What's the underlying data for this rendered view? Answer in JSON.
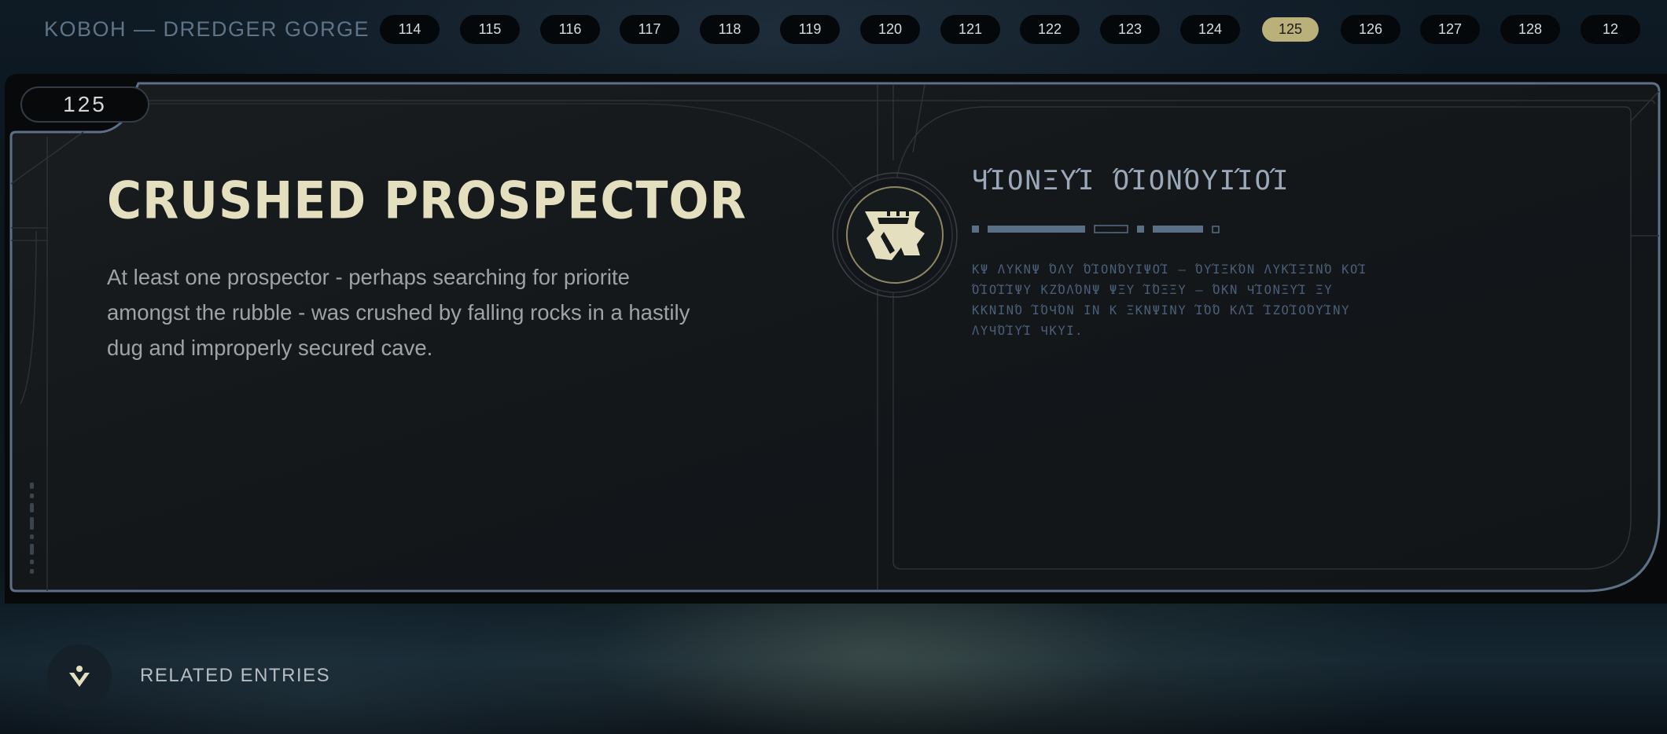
{
  "header": {
    "location": "KOBOH — DREDGER GORGE",
    "entries": [
      "114",
      "115",
      "116",
      "117",
      "118",
      "119",
      "120",
      "121",
      "122",
      "123",
      "124",
      "125",
      "126",
      "127",
      "128",
      "12"
    ],
    "active_entry": "125"
  },
  "entry": {
    "number": "125",
    "title": "CRUSHED PROSPECTOR",
    "description": "At least one prospector - perhaps searching for priorite amongst the rubble - was crushed by falling rocks in a hastily dug and improperly secured cave.",
    "aurebesh_title": "ЧΊΟΝΞΥΊ ΌΊΟΝΌΥΙΊΟΊ",
    "aurebesh_lines": [
      "ΚΨ ΛΥΚΝΨ ΌΛΥ ΌΊΟΝΌΥΙΨΟΊ – ΌΥΊΞΚΌΝ ΛΥΚΊΞΙΝΌ ΚΟΊ",
      "ΌΊΟΊΊΨΥ ΚΖΌΛΌΝΨ ΨΞΥ ΊΌΞΞΥ – ΌΚΝ ЧΊΟΝΞΥΊ ΞΥ",
      "ΚΚΝΙΝΌ ΊΌЧΌΝ ΙΝ Κ ΞΚΝΨΙΝΥ ΊΌΌ ΚΛΊ ΊΖΟΊΟΌΥΊΝΥ",
      "ΛΥЧΌΊΥΊ ЧΚΥΙ."
    ],
    "emblem_icon": "cave-glyph-icon"
  },
  "footer": {
    "related_label": "RELATED ENTRIES",
    "related_icon": "person-down-icon"
  },
  "colors": {
    "accent": "#b9b07a",
    "title": "#e4dfbe",
    "panel": "#13171a",
    "frame": "#5d7085"
  }
}
